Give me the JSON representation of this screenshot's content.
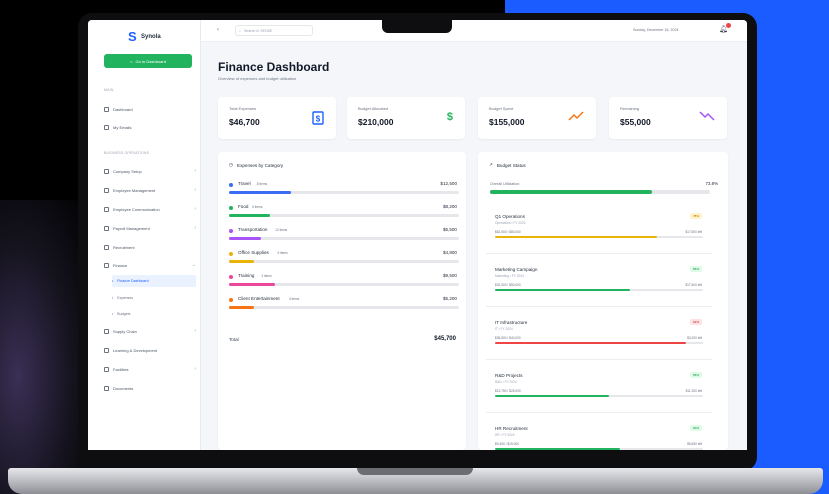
{
  "brand": {
    "name": "Synola",
    "cta_label": "Go to Dashboard"
  },
  "sidebar": {
    "section_main": "MAIN",
    "main_items": [
      {
        "label": "Dashboard"
      },
      {
        "label": "My Emails"
      }
    ],
    "section_business": "BUSINESS OPERATIONS",
    "items": [
      {
        "label": "Company Setup"
      },
      {
        "label": "Employee Management"
      },
      {
        "label": "Employee Communication"
      },
      {
        "label": "Payroll Management"
      },
      {
        "label": "Recruitment"
      },
      {
        "label": "Finance"
      },
      {
        "label": "Finance Dashboard"
      },
      {
        "label": "Expenses"
      },
      {
        "label": "Budgets"
      },
      {
        "label": "Supply Chain"
      },
      {
        "label": "Learning & Development"
      },
      {
        "label": "Facilities"
      },
      {
        "label": "Documents"
      }
    ]
  },
  "topbar": {
    "search_placeholder": "Search in SENSE",
    "date": "Sunday, December 16, 2024"
  },
  "page": {
    "title": "Finance Dashboard",
    "subtitle": "Overview of expenses and budget utilization"
  },
  "stats": [
    {
      "label": "Total Expenses",
      "value": "$46,700",
      "icon": "receipt-icon",
      "color": "#1d63ff"
    },
    {
      "label": "Budget Allocated",
      "value": "$210,000",
      "icon": "dollar-icon",
      "color": "#22b35e"
    },
    {
      "label": "Budget Spent",
      "value": "$155,000",
      "icon": "trend-up-icon",
      "color": "#f97316"
    },
    {
      "label": "Remaining",
      "value": "$55,000",
      "icon": "trend-down-icon",
      "color": "#a855f7"
    }
  ],
  "expenses": {
    "title": "Expenses by Category",
    "items": [
      {
        "name": "Travel",
        "badge": "8 items",
        "amount": "$12,500",
        "color": "#3b6cf5",
        "pct": 0.27
      },
      {
        "name": "Food",
        "badge": "6 items",
        "amount": "$8,200",
        "color": "#22b35e",
        "pct": 0.18
      },
      {
        "name": "Transportation",
        "badge": "12 items",
        "amount": "$6,500",
        "color": "#a855f7",
        "pct": 0.14
      },
      {
        "name": "Office Supplies",
        "badge": "5 items",
        "amount": "$4,800",
        "color": "#eab308",
        "pct": 0.11
      },
      {
        "name": "Training",
        "badge": "3 items",
        "amount": "$9,500",
        "color": "#ec4899",
        "pct": 0.2
      },
      {
        "name": "Client Entertainment",
        "badge": "4 items",
        "amount": "$5,200",
        "color": "#f97316",
        "pct": 0.11
      }
    ],
    "total_label": "Total",
    "total_value": "$45,700"
  },
  "budget": {
    "title": "Budget Status",
    "overall_label": "Overall Utilization",
    "overall_value": "73.8%",
    "overall_pct": 0.738,
    "items": [
      {
        "name": "Q1 Operations",
        "meta": "Operations • FY 2024",
        "pill": "78%",
        "pill_bg": "#fef3c7",
        "pill_fg": "#b45309",
        "amount": "$62,500 / $80,000",
        "remaining": "$17,500 left",
        "color": "#eab308",
        "pct": 0.78
      },
      {
        "name": "Marketing Campaign",
        "meta": "Marketing • FY 2024",
        "pill": "65%",
        "pill_bg": "#dcfce7",
        "pill_fg": "#15803d",
        "amount": "$32,500 / $50,000",
        "remaining": "$17,500 left",
        "color": "#22b35e",
        "pct": 0.65
      },
      {
        "name": "IT Infrastructure",
        "meta": "IT • FY 2024",
        "pill": "92%",
        "pill_bg": "#fee2e2",
        "pill_fg": "#b91c1c",
        "amount": "$36,800 / $40,000",
        "remaining": "$3,200 left",
        "color": "#ef4444",
        "pct": 0.92
      },
      {
        "name": "R&D Projects",
        "meta": "R&D • FY 2024",
        "pill": "55%",
        "pill_bg": "#dcfce7",
        "pill_fg": "#15803d",
        "amount": "$13,750 / $25,000",
        "remaining": "$11,250 left",
        "color": "#22b35e",
        "pct": 0.55
      },
      {
        "name": "HR Recruitment",
        "meta": "HR • FY 2024",
        "pill": "60%",
        "pill_bg": "#dcfce7",
        "pill_fg": "#15803d",
        "amount": "$9,450 / $15,000",
        "remaining": "$5,550 left",
        "color": "#22b35e",
        "pct": 0.6
      }
    ]
  }
}
